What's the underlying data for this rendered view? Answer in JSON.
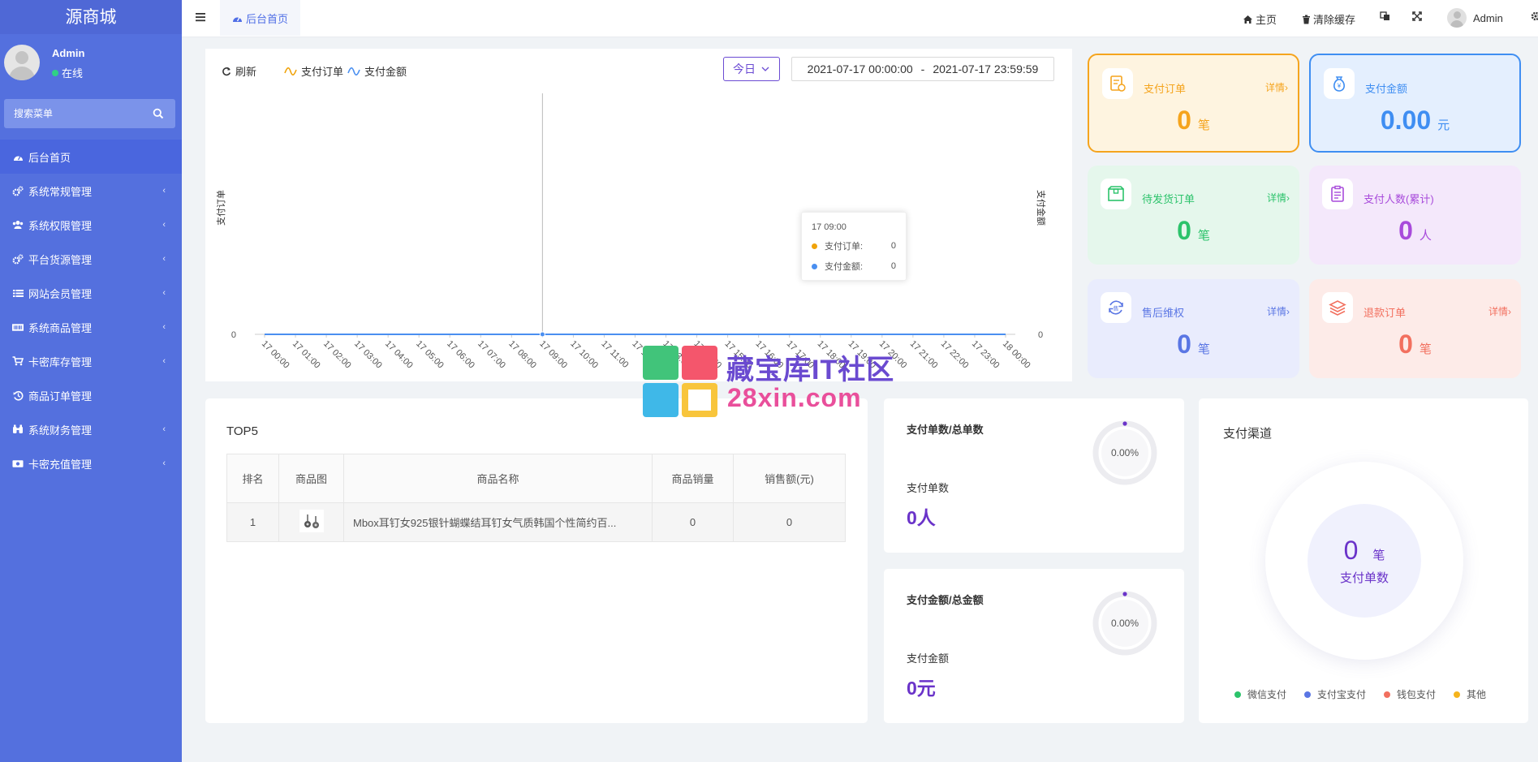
{
  "sidebar": {
    "brand": "源商城",
    "user": {
      "name": "Admin",
      "status": "在线"
    },
    "search_placeholder": "搜索菜单",
    "items": [
      {
        "label": "后台首页",
        "icon": "dashboard-icon",
        "active": true,
        "has_submenu": false
      },
      {
        "label": "系统常规管理",
        "icon": "cogs-icon",
        "has_submenu": true
      },
      {
        "label": "系统权限管理",
        "icon": "users-icon",
        "has_submenu": true
      },
      {
        "label": "平台货源管理",
        "icon": "cogs-icon",
        "has_submenu": true
      },
      {
        "label": "网站会员管理",
        "icon": "list-icon",
        "has_submenu": true
      },
      {
        "label": "系统商品管理",
        "icon": "barcode-icon",
        "has_submenu": true
      },
      {
        "label": "卡密库存管理",
        "icon": "cart-icon",
        "has_submenu": true
      },
      {
        "label": "商品订单管理",
        "icon": "history-icon",
        "has_submenu": false
      },
      {
        "label": "系统财务管理",
        "icon": "binoculars-icon",
        "has_submenu": true
      },
      {
        "label": "卡密充值管理",
        "icon": "money-icon",
        "has_submenu": true
      }
    ],
    "chevron": "‹"
  },
  "topbar": {
    "tab": "后台首页",
    "home": "主页",
    "clear_cache": "清除缓存",
    "admin": "Admin"
  },
  "chart_panel": {
    "refresh": "刷新",
    "legend_orders": "支付订单",
    "legend_amount": "支付金额",
    "today": "今日",
    "date_start": "2021-07-17 00:00:00",
    "date_sep": "-",
    "date_end": "2021-07-17 23:59:59",
    "tooltip": {
      "time": "17 09:00",
      "orders_label": "支付订单:",
      "orders_value": "0",
      "amount_label": "支付金额:",
      "amount_value": "0"
    }
  },
  "chart_data": {
    "type": "line",
    "x": [
      "17 00:00",
      "17 01:00",
      "17 02:00",
      "17 03:00",
      "17 04:00",
      "17 05:00",
      "17 06:00",
      "17 07:00",
      "17 08:00",
      "17 09:00",
      "17 10:00",
      "17 11:00",
      "17 12:00",
      "17 13:00",
      "17 14:00",
      "17 15:00",
      "17 16:00",
      "17 17:00",
      "17 18:00",
      "17 19:00",
      "17 20:00",
      "17 21:00",
      "17 22:00",
      "17 23:00",
      "18 00:00"
    ],
    "series": [
      {
        "name": "支付订单",
        "color": "#f0a30a",
        "axis": "left",
        "values": [
          0,
          0,
          0,
          0,
          0,
          0,
          0,
          0,
          0,
          0,
          0,
          0,
          0,
          0,
          0,
          0,
          0,
          0,
          0,
          0,
          0,
          0,
          0,
          0,
          0
        ]
      },
      {
        "name": "支付金额",
        "color": "#4a8ff0",
        "axis": "right",
        "values": [
          0,
          0,
          0,
          0,
          0,
          0,
          0,
          0,
          0,
          0,
          0,
          0,
          0,
          0,
          0,
          0,
          0,
          0,
          0,
          0,
          0,
          0,
          0,
          0,
          0
        ]
      }
    ],
    "ylabel_left": "支付订单",
    "ylabel_right": "支付金额",
    "y_tick_left": "0",
    "y_tick_right": "0",
    "hover_index": 9
  },
  "stats": [
    {
      "title": "支付订单",
      "detail": "详情›",
      "value": "0",
      "unit": "笔",
      "color": "#f5a41d",
      "bg": "#fef4e0",
      "icon": "order-icon"
    },
    {
      "title": "支付金额",
      "detail": "",
      "value": "0.00",
      "unit": "元",
      "color": "#3f8ef2",
      "bg": "#e4effe",
      "icon": "money-bag-icon"
    },
    {
      "title": "待发货订单",
      "detail": "详情›",
      "value": "0",
      "unit": "笔",
      "color": "#2cc36b",
      "bg": "#e5f7ec",
      "icon": "box-icon"
    },
    {
      "title": "支付人数(累计)",
      "detail": "",
      "value": "0",
      "unit": "人",
      "color": "#a84bdb",
      "bg": "#f4e8fb",
      "icon": "clipboard-icon"
    },
    {
      "title": "售后维权",
      "detail": "详情›",
      "value": "0",
      "unit": "笔",
      "color": "#5a76e4",
      "bg": "#e9ecfd",
      "icon": "after-sale-icon"
    },
    {
      "title": "退款订单",
      "detail": "详情›",
      "value": "0",
      "unit": "笔",
      "color": "#f2705f",
      "bg": "#fdebe8",
      "icon": "layers-icon"
    }
  ],
  "top5": {
    "title": "TOP5",
    "headers": [
      "排名",
      "商品图",
      "商品名称",
      "商品销量",
      "销售额(元)"
    ],
    "rows": [
      {
        "rank": "1",
        "name": "Mbox耳钉女925银针蝴蝶结耳钉女气质韩国个性简约百...",
        "sales": "0",
        "amount": "0"
      }
    ]
  },
  "ratio_orders": {
    "title": "支付单数/总单数",
    "percent": "0.00%",
    "label": "支付单数",
    "value": "0人"
  },
  "ratio_amount": {
    "title": "支付金额/总金额",
    "percent": "0.00%",
    "label": "支付金额",
    "value": "0元"
  },
  "channels": {
    "title": "支付渠道",
    "count": "0",
    "unit": "笔",
    "label": "支付单数",
    "legend": [
      {
        "name": "微信支付",
        "color": "#2cc36b"
      },
      {
        "name": "支付宝支付",
        "color": "#5a76e4"
      },
      {
        "name": "钱包支付",
        "color": "#f2705f"
      },
      {
        "name": "其他",
        "color": "#f5b41d"
      }
    ]
  },
  "watermark": {
    "line1": "藏宝库IT社区",
    "line2": "28xin.com"
  }
}
